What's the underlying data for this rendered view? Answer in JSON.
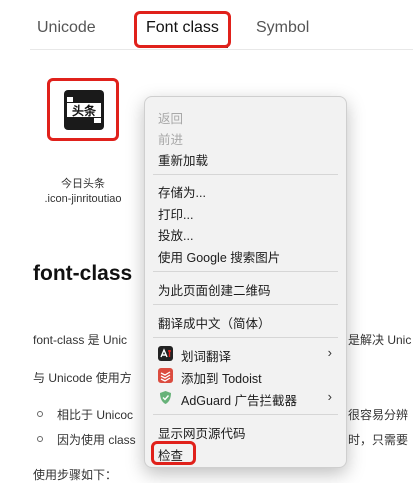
{
  "tabs": {
    "unicode": "Unicode",
    "font_class": "Font class",
    "symbol": "Symbol",
    "active": "font_class"
  },
  "icon": {
    "name": "今日头条",
    "class": ".icon-jinritoutiao",
    "glyph": "头条"
  },
  "section": {
    "heading": "font-class",
    "p1": "font-class 是 Unic",
    "p1_right": "是解决 Unic",
    "p2": "与 Unicode 使用方",
    "li1": "相比于 Unicoc",
    "li1_right": "很容易分辨",
    "li2": "因为使用 class",
    "li2_right": "时，只需要",
    "bottom_partial": "使用步骤如下："
  },
  "context_menu": {
    "back": "返回",
    "forward": "前进",
    "reload": "重新加载",
    "save_as": "存储为...",
    "print": "打印...",
    "cast": "投放...",
    "search_image": "使用 Google 搜索图片",
    "qr_code": "为此页面创建二维码",
    "translate": "翻译成中文（简体）",
    "word_translate": "划词翻译",
    "add_todoist": "添加到 Todoist",
    "adguard": "AdGuard 广告拦截器",
    "view_source": "显示网页源代码",
    "inspect": "检查",
    "chevron": "›"
  },
  "colors": {
    "highlight_red": "#e0211b",
    "todoist_red": "#db4c3f",
    "adguard_green": "#67b279"
  }
}
